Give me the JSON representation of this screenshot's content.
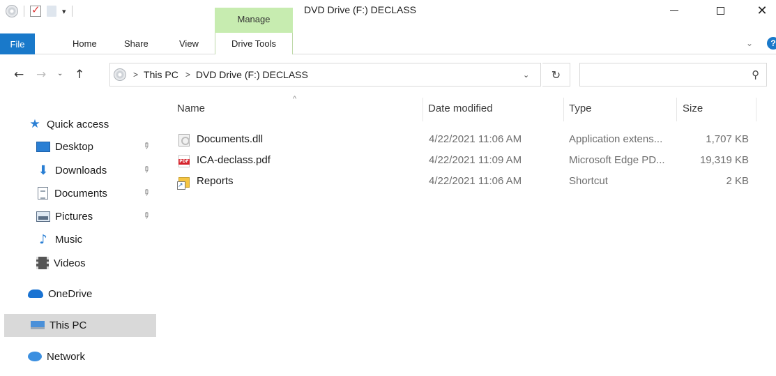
{
  "window": {
    "title": "DVD Drive (F:) DECLASS",
    "contextual_tab_group": "Manage"
  },
  "qat": {
    "icons": [
      "dvd-drive-icon",
      "properties-icon",
      "new-folder-icon",
      "customize-qat-icon"
    ],
    "dropdown_glyph": "▾"
  },
  "ribbon": {
    "tabs": [
      "File",
      "Home",
      "Share",
      "View",
      "Drive Tools"
    ],
    "chevron": "⌄",
    "help": "?"
  },
  "nav": {
    "back": "←",
    "forward": "→",
    "recent": "⌄",
    "up": "↑",
    "breadcrumbs": [
      "This PC",
      "DVD Drive (F:) DECLASS"
    ],
    "separator": ">",
    "address_dropdown": "⌄",
    "refresh": "↻"
  },
  "search": {
    "placeholder": "",
    "value": "",
    "icon": "⚲"
  },
  "sidebar": {
    "items": [
      {
        "label": "Quick access",
        "icon": "star-icon",
        "pinned": false
      },
      {
        "label": "Desktop",
        "icon": "desktop-icon",
        "pinned": true
      },
      {
        "label": "Downloads",
        "icon": "downloads-icon",
        "pinned": true
      },
      {
        "label": "Documents",
        "icon": "documents-icon",
        "pinned": true
      },
      {
        "label": "Pictures",
        "icon": "pictures-icon",
        "pinned": true
      },
      {
        "label": "Music",
        "icon": "music-icon",
        "pinned": false
      },
      {
        "label": "Videos",
        "icon": "videos-icon",
        "pinned": false
      },
      {
        "label": "OneDrive",
        "icon": "onedrive-icon",
        "pinned": false
      },
      {
        "label": "This PC",
        "icon": "this-pc-icon",
        "pinned": false,
        "selected": true
      },
      {
        "label": "Network",
        "icon": "network-icon",
        "pinned": false
      }
    ],
    "pin_glyph": "📌"
  },
  "details": {
    "columns": [
      "Name",
      "Date modified",
      "Type",
      "Size"
    ],
    "sort_glyph": "^",
    "rows": [
      {
        "name": "Documents.dll",
        "date": "4/22/2021 11:06 AM",
        "type": "Application extens...",
        "size": "1,707 KB",
        "icon": "dll-file-icon"
      },
      {
        "name": "ICA-declass.pdf",
        "date": "4/22/2021 11:09 AM",
        "type": "Microsoft Edge PD...",
        "size": "19,319 KB",
        "icon": "pdf-file-icon"
      },
      {
        "name": "Reports",
        "date": "4/22/2021 11:06 AM",
        "type": "Shortcut",
        "size": "2 KB",
        "icon": "shortcut-folder-icon"
      }
    ]
  },
  "colors": {
    "accent": "#1979ca",
    "manage_tab": "#c7ecb0",
    "selection": "#d9d9d9"
  }
}
